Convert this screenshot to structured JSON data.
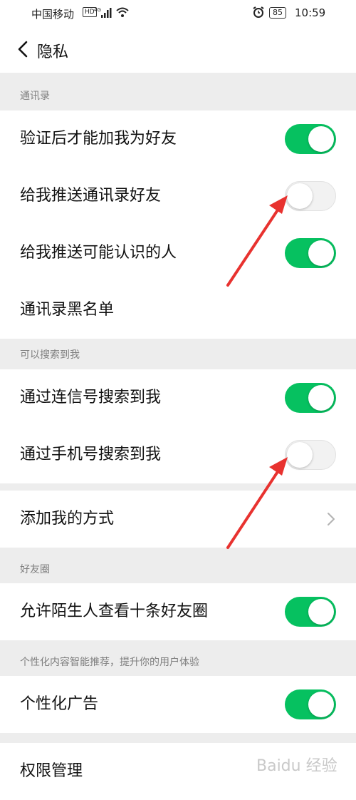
{
  "status_bar": {
    "carrier": "中国移动",
    "hd": "HD",
    "network": "4G",
    "battery": "85",
    "time": "10:59"
  },
  "nav": {
    "title": "隐私"
  },
  "sections": {
    "contacts": {
      "header": "通讯录"
    },
    "search": {
      "header": "可以搜索到我"
    },
    "moments": {
      "header": "好友圈"
    },
    "personalization": {
      "header": "个性化内容智能推荐，提升你的用户体验"
    }
  },
  "rows": {
    "verify_friend": {
      "label": "验证后才能加我为好友",
      "enabled": true
    },
    "push_contacts": {
      "label": "给我推送通讯录好友",
      "enabled": false
    },
    "push_may_know": {
      "label": "给我推送可能认识的人",
      "enabled": true
    },
    "blacklist": {
      "label": "通讯录黑名单"
    },
    "search_by_id": {
      "label": "通过连信号搜索到我",
      "enabled": true
    },
    "search_by_phone": {
      "label": "通过手机号搜索到我",
      "enabled": false
    },
    "add_methods": {
      "label": "添加我的方式"
    },
    "stranger_moments": {
      "label": "允许陌生人查看十条好友圈",
      "enabled": true
    },
    "personalized_ads": {
      "label": "个性化广告",
      "enabled": true
    },
    "permissions": {
      "label": "权限管理"
    }
  },
  "watermark": "Baidu 经验",
  "colors": {
    "toggle_on": "#06c160",
    "arrow": "#e8322f",
    "background": "#ededed"
  }
}
